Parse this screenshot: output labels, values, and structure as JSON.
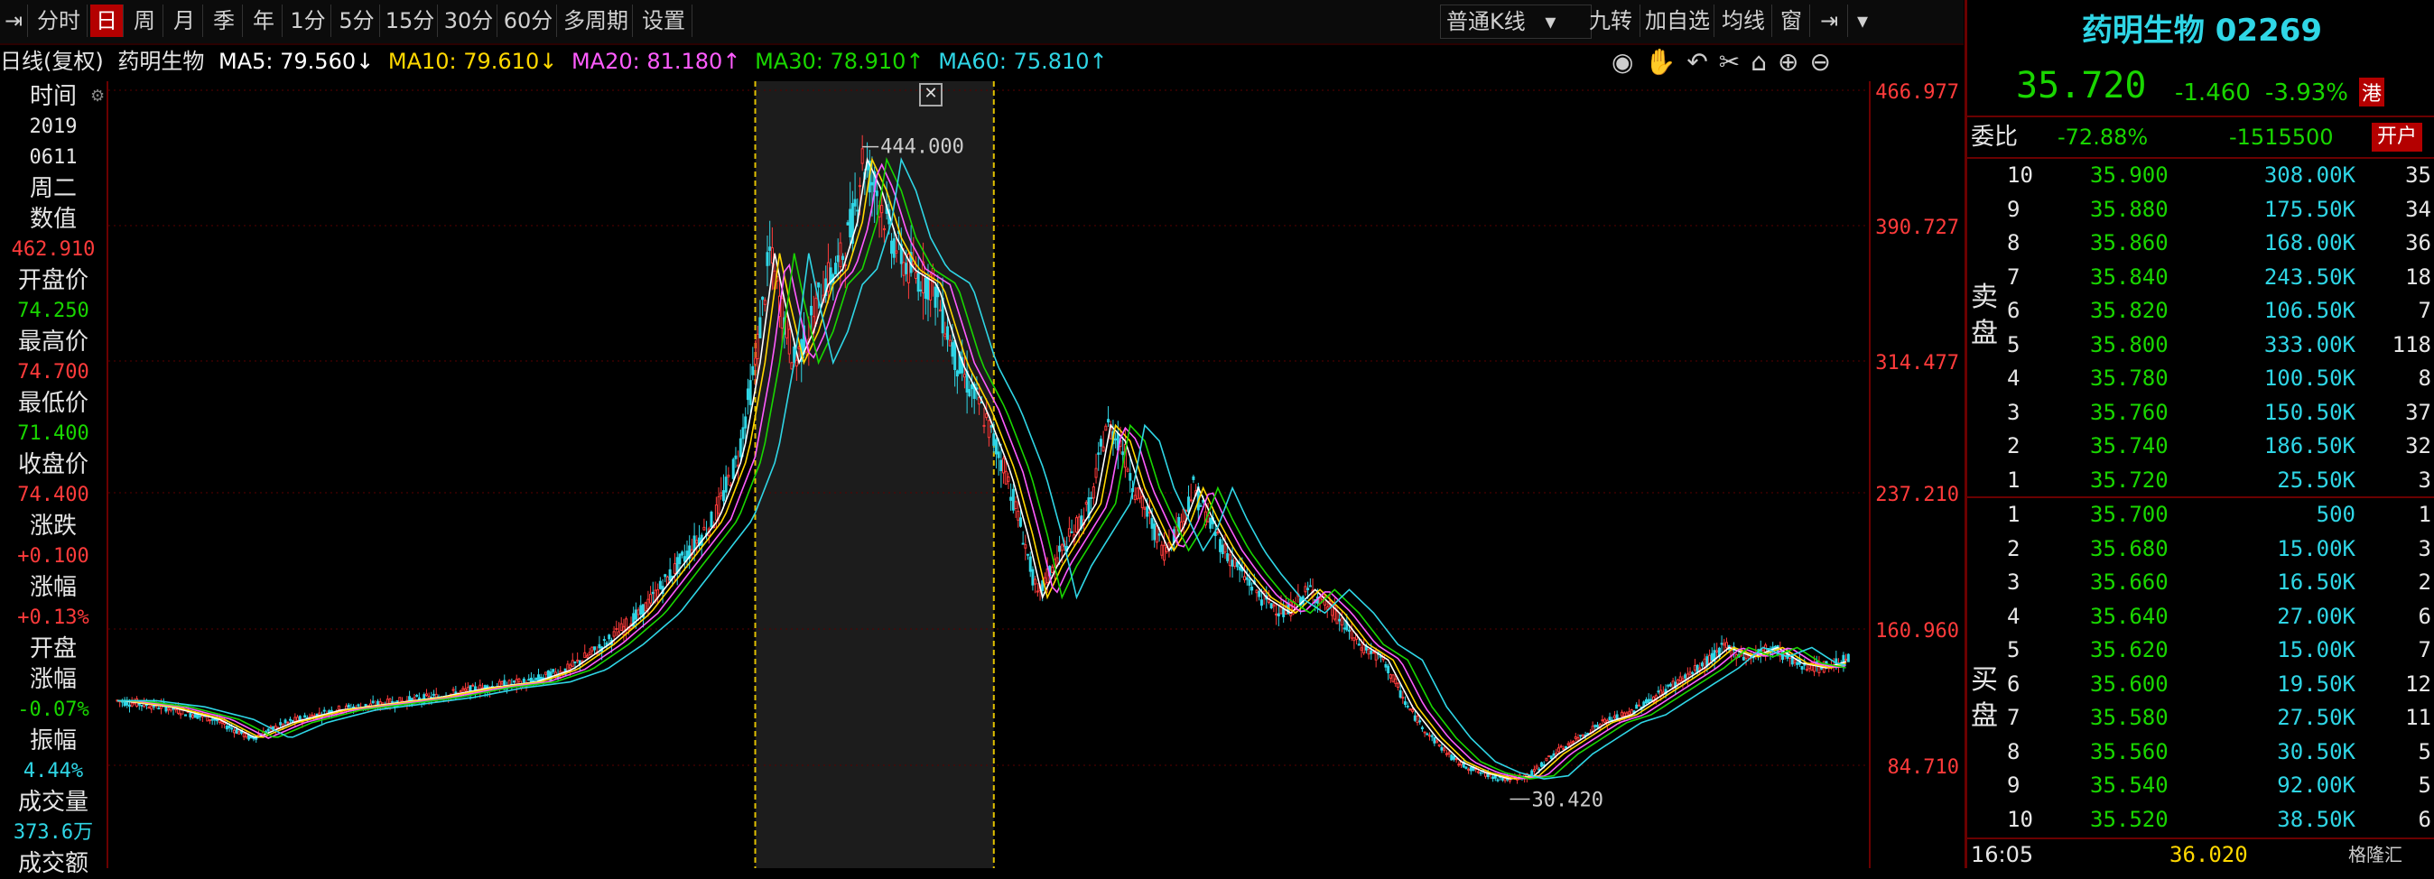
{
  "toolbar": {
    "left_items": [
      "分时",
      "日",
      "周",
      "月",
      "季",
      "年",
      "1分",
      "5分",
      "15分",
      "30分",
      "60分",
      "多周期",
      "设置"
    ],
    "active": "日",
    "kline_type": "普通K线",
    "right_items": [
      "九转",
      "加自选",
      "均线",
      "窗"
    ]
  },
  "ma_bar": {
    "label": "日线(复权)",
    "stock": "药明生物",
    "ma5": "MA5: 79.560↓",
    "ma10": "MA10: 79.610↓",
    "ma20": "MA20: 81.180↑",
    "ma30": "MA30: 78.910↑",
    "ma60": "MA60: 75.810↑",
    "colors": {
      "ma5": "#ffffff",
      "ma10": "#ffd800",
      "ma20": "#ff5cff",
      "ma30": "#19d600",
      "ma60": "#2fd6e6"
    }
  },
  "info_panel": [
    {
      "label": "时间",
      "value": "2019",
      "color": "white"
    },
    {
      "label": "",
      "value": "0611",
      "color": "white"
    },
    {
      "label": "周二",
      "value": "",
      "color": "white"
    },
    {
      "label": "数值",
      "value": "462.910",
      "color": "red"
    },
    {
      "label": "开盘价",
      "value": "74.250",
      "color": "green"
    },
    {
      "label": "最高价",
      "value": "74.700",
      "color": "red"
    },
    {
      "label": "最低价",
      "value": "71.400",
      "color": "green"
    },
    {
      "label": "收盘价",
      "value": "74.400",
      "color": "red"
    },
    {
      "label": "涨跌",
      "value": "+0.100",
      "color": "red"
    },
    {
      "label": "涨幅",
      "value": "+0.13%",
      "color": "red"
    },
    {
      "label": "开盘",
      "value": "",
      "color": "white"
    },
    {
      "label": "涨幅",
      "value": "-0.07%",
      "color": "green"
    },
    {
      "label": "振幅",
      "value": "4.44%",
      "color": "cyan"
    },
    {
      "label": "成交量",
      "value": "373.6万",
      "color": "cyan"
    },
    {
      "label": "成交额",
      "value": "",
      "color": "white"
    }
  ],
  "chart_data": {
    "type": "candlestick",
    "y_ticks": [
      "466.977",
      "390.727",
      "314.477",
      "237.210",
      "160.960",
      "84.710"
    ],
    "ylim": [
      0,
      480
    ],
    "high_label": "444.000",
    "low_label": "30.420",
    "close_path": [
      [
        0,
        84
      ],
      [
        20,
        80
      ],
      [
        40,
        72
      ],
      [
        55,
        60
      ],
      [
        70,
        70
      ],
      [
        90,
        78
      ],
      [
        110,
        82
      ],
      [
        130,
        86
      ],
      [
        150,
        92
      ],
      [
        170,
        96
      ],
      [
        185,
        104
      ],
      [
        200,
        120
      ],
      [
        215,
        140
      ],
      [
        230,
        170
      ],
      [
        245,
        200
      ],
      [
        255,
        240
      ],
      [
        262,
        300
      ],
      [
        268,
        370
      ],
      [
        272,
        340
      ],
      [
        278,
        300
      ],
      [
        284,
        320
      ],
      [
        290,
        350
      ],
      [
        296,
        360
      ],
      [
        302,
        390
      ],
      [
        306,
        430
      ],
      [
        312,
        410
      ],
      [
        318,
        380
      ],
      [
        325,
        360
      ],
      [
        335,
        350
      ],
      [
        345,
        300
      ],
      [
        355,
        270
      ],
      [
        365,
        230
      ],
      [
        372,
        190
      ],
      [
        378,
        150
      ],
      [
        384,
        170
      ],
      [
        392,
        190
      ],
      [
        400,
        210
      ],
      [
        406,
        260
      ],
      [
        412,
        250
      ],
      [
        418,
        220
      ],
      [
        424,
        200
      ],
      [
        430,
        180
      ],
      [
        436,
        195
      ],
      [
        442,
        220
      ],
      [
        448,
        200
      ],
      [
        455,
        180
      ],
      [
        462,
        165
      ],
      [
        470,
        150
      ],
      [
        480,
        140
      ],
      [
        490,
        155
      ],
      [
        500,
        140
      ],
      [
        510,
        120
      ],
      [
        520,
        110
      ],
      [
        530,
        80
      ],
      [
        540,
        60
      ],
      [
        550,
        45
      ],
      [
        560,
        38
      ],
      [
        570,
        34
      ],
      [
        580,
        36
      ],
      [
        590,
        50
      ],
      [
        600,
        60
      ],
      [
        610,
        70
      ],
      [
        620,
        75
      ],
      [
        630,
        85
      ],
      [
        640,
        95
      ],
      [
        650,
        105
      ],
      [
        660,
        118
      ],
      [
        670,
        112
      ],
      [
        680,
        118
      ],
      [
        690,
        108
      ],
      [
        700,
        105
      ],
      [
        710,
        110
      ]
    ],
    "ma_color": "#2fd6e6",
    "selection_band": {
      "from_x_index": 262,
      "to_x_index": 360
    },
    "x_max": 712
  },
  "right_panel": {
    "title": "药明生物 02269",
    "price": "35.720",
    "change": "-1.460",
    "change_pct": "-3.93%",
    "market_badge": "港",
    "ratio_label": "委比",
    "ratio_pct": "-72.88%",
    "ratio_diff": "-1515500",
    "open_acct": "开户",
    "sell_label": "卖盘",
    "buy_label": "买盘",
    "sell": [
      {
        "lvl": "10",
        "price": "35.900",
        "vol": "308.00K",
        "cnt": "35"
      },
      {
        "lvl": "9",
        "price": "35.880",
        "vol": "175.50K",
        "cnt": "34"
      },
      {
        "lvl": "8",
        "price": "35.860",
        "vol": "168.00K",
        "cnt": "36"
      },
      {
        "lvl": "7",
        "price": "35.840",
        "vol": "243.50K",
        "cnt": "18"
      },
      {
        "lvl": "6",
        "price": "35.820",
        "vol": "106.50K",
        "cnt": "7"
      },
      {
        "lvl": "5",
        "price": "35.800",
        "vol": "333.00K",
        "cnt": "118"
      },
      {
        "lvl": "4",
        "price": "35.780",
        "vol": "100.50K",
        "cnt": "8"
      },
      {
        "lvl": "3",
        "price": "35.760",
        "vol": "150.50K",
        "cnt": "37"
      },
      {
        "lvl": "2",
        "price": "35.740",
        "vol": "186.50K",
        "cnt": "32"
      },
      {
        "lvl": "1",
        "price": "35.720",
        "vol": "25.50K",
        "cnt": "3"
      }
    ],
    "buy": [
      {
        "lvl": "1",
        "price": "35.700",
        "vol": "500",
        "cnt": "1"
      },
      {
        "lvl": "2",
        "price": "35.680",
        "vol": "15.00K",
        "cnt": "3"
      },
      {
        "lvl": "3",
        "price": "35.660",
        "vol": "16.50K",
        "cnt": "2"
      },
      {
        "lvl": "4",
        "price": "35.640",
        "vol": "27.00K",
        "cnt": "6"
      },
      {
        "lvl": "5",
        "price": "35.620",
        "vol": "15.00K",
        "cnt": "7"
      },
      {
        "lvl": "6",
        "price": "35.600",
        "vol": "19.50K",
        "cnt": "12"
      },
      {
        "lvl": "7",
        "price": "35.580",
        "vol": "27.50K",
        "cnt": "11"
      },
      {
        "lvl": "8",
        "price": "35.560",
        "vol": "30.50K",
        "cnt": "5"
      },
      {
        "lvl": "9",
        "price": "35.540",
        "vol": "92.00K",
        "cnt": "5"
      },
      {
        "lvl": "10",
        "price": "35.520",
        "vol": "38.50K",
        "cnt": "6"
      }
    ],
    "footer_time": "16:05",
    "footer_price": "36.020",
    "watermark": "格隆汇"
  }
}
